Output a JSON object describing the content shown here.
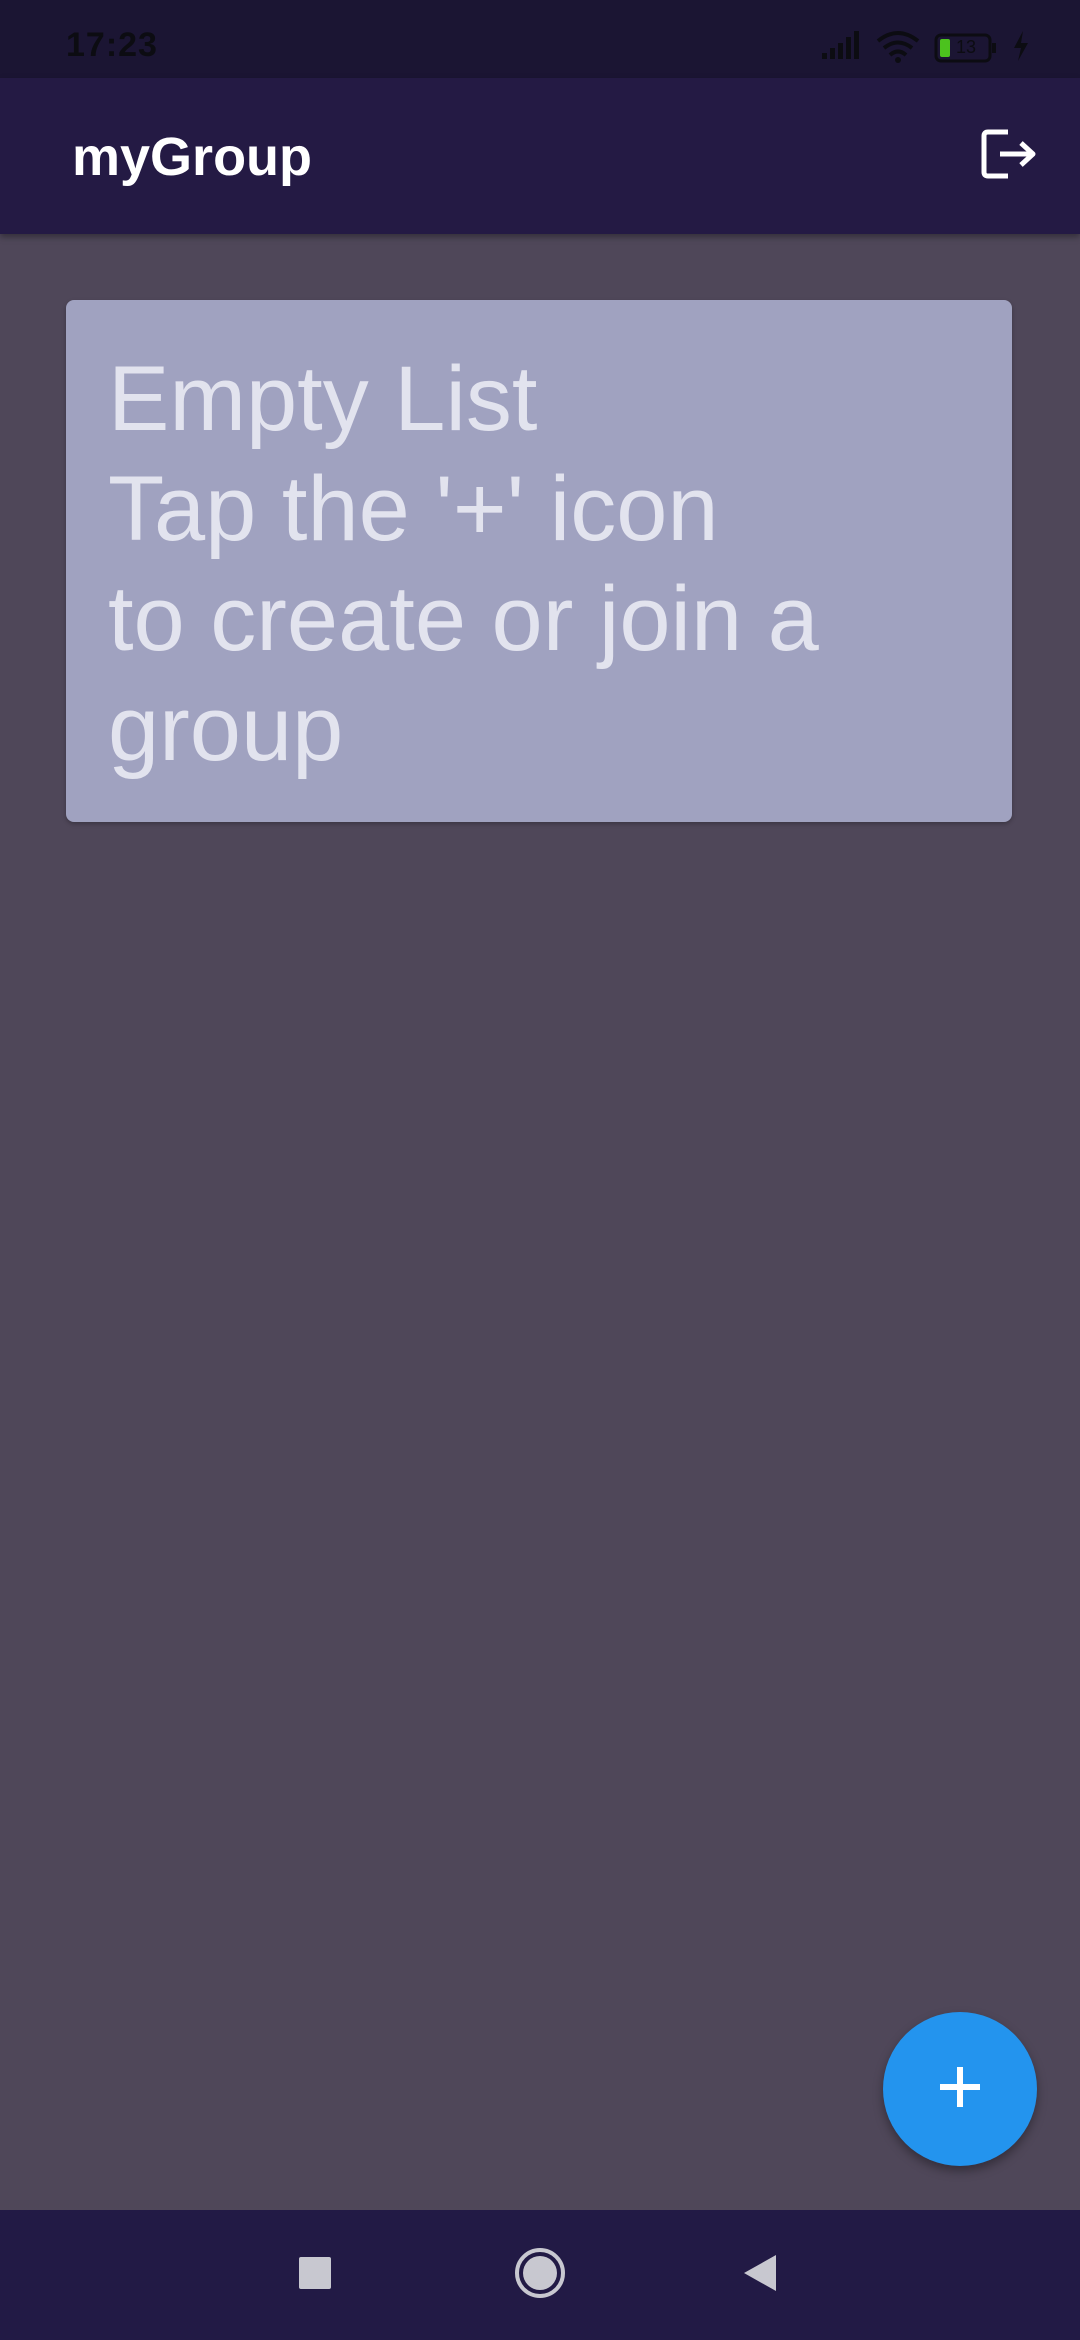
{
  "status_bar": {
    "time": "17:23",
    "battery_level": "13",
    "icons": [
      "signal-icon",
      "wifi-icon",
      "battery-icon",
      "charging-icon"
    ]
  },
  "app_bar": {
    "title": "myGroup",
    "action_icon": "logout-icon"
  },
  "empty_state": {
    "lines": [
      "Empty List",
      "Tap the '+' icon",
      "to create or join a",
      "group"
    ]
  },
  "fab": {
    "icon": "plus-icon",
    "label": "+"
  },
  "nav_bar": {
    "buttons": [
      "recents-button",
      "home-button",
      "back-button"
    ]
  },
  "colors": {
    "background": "#4f4759",
    "app_bar": "#241a44",
    "card": "#a0a2c0",
    "fab": "#2394ee",
    "battery_fill": "#4cc21e"
  }
}
